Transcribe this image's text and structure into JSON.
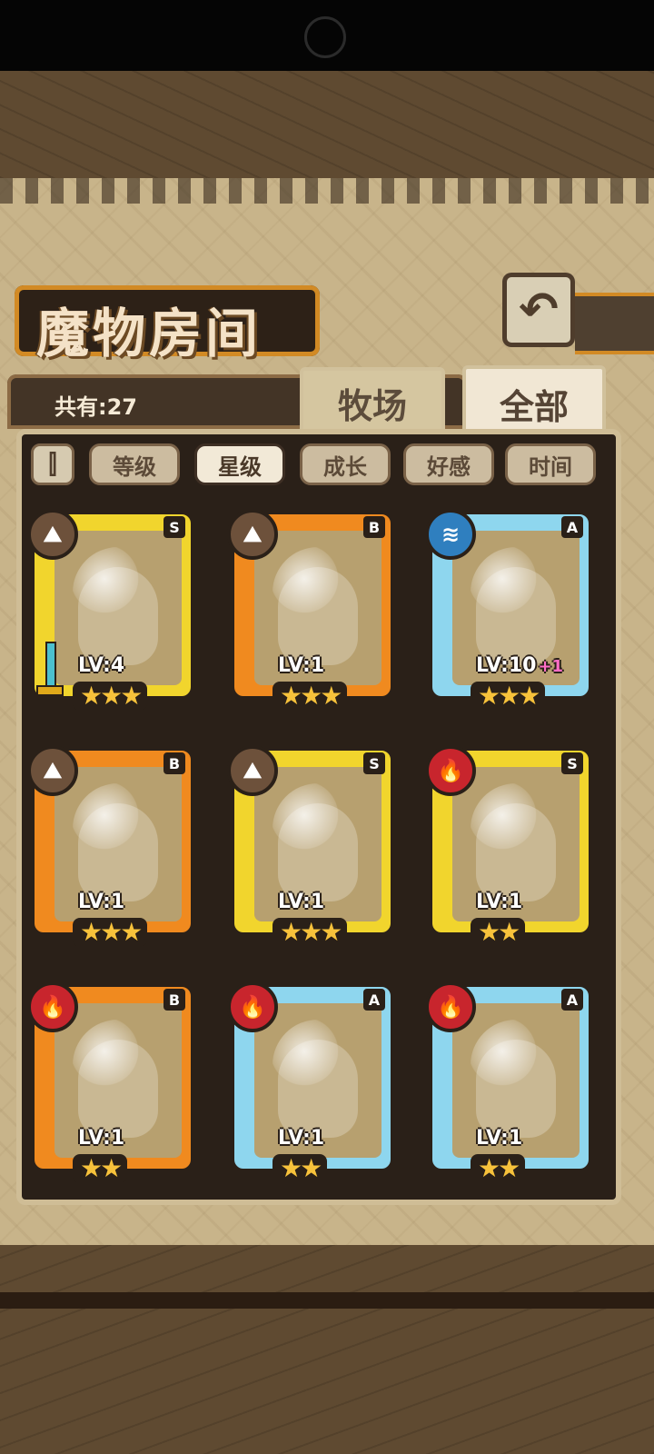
{
  "header": {
    "title": "魔物房间",
    "back_icon": "back-arrow-icon",
    "count_text": "共有:27"
  },
  "tabs": [
    {
      "label": "牧场",
      "active": false
    },
    {
      "label": "全部",
      "active": true
    }
  ],
  "filters": {
    "order_icon": "sort-order-icon",
    "items": [
      {
        "label": "等级",
        "selected": false
      },
      {
        "label": "星级",
        "selected": true
      },
      {
        "label": "成长",
        "selected": false
      },
      {
        "label": "好感",
        "selected": false
      },
      {
        "label": "时间",
        "selected": false
      }
    ]
  },
  "cards": [
    {
      "grade": "S",
      "level": "LV:4",
      "plus": "",
      "stars": "★★★",
      "element": "earth",
      "frame_color": "#f1d52d",
      "has_weapon": true
    },
    {
      "grade": "B",
      "level": "LV:1",
      "plus": "",
      "stars": "★★★",
      "element": "earth",
      "frame_color": "#f08a1f",
      "has_weapon": false
    },
    {
      "grade": "A",
      "level": "LV:10",
      "plus": "+1",
      "stars": "★★★",
      "element": "water",
      "frame_color": "#8ed6ee",
      "has_weapon": false
    },
    {
      "grade": "B",
      "level": "LV:1",
      "plus": "",
      "stars": "★★★",
      "element": "earth",
      "frame_color": "#f08a1f",
      "has_weapon": false
    },
    {
      "grade": "S",
      "level": "LV:1",
      "plus": "",
      "stars": "★★★",
      "element": "earth",
      "frame_color": "#f1d52d",
      "has_weapon": false
    },
    {
      "grade": "S",
      "level": "LV:1",
      "plus": "",
      "stars": "★★",
      "element": "fire",
      "frame_color": "#f1d52d",
      "has_weapon": false
    },
    {
      "grade": "B",
      "level": "LV:1",
      "plus": "",
      "stars": "★★",
      "element": "fire",
      "frame_color": "#f08a1f",
      "has_weapon": false
    },
    {
      "grade": "A",
      "level": "LV:1",
      "plus": "",
      "stars": "★★",
      "element": "fire",
      "frame_color": "#8ed6ee",
      "has_weapon": false
    },
    {
      "grade": "A",
      "level": "LV:1",
      "plus": "",
      "stars": "★★",
      "element": "fire",
      "frame_color": "#8ed6ee",
      "has_weapon": false
    }
  ]
}
